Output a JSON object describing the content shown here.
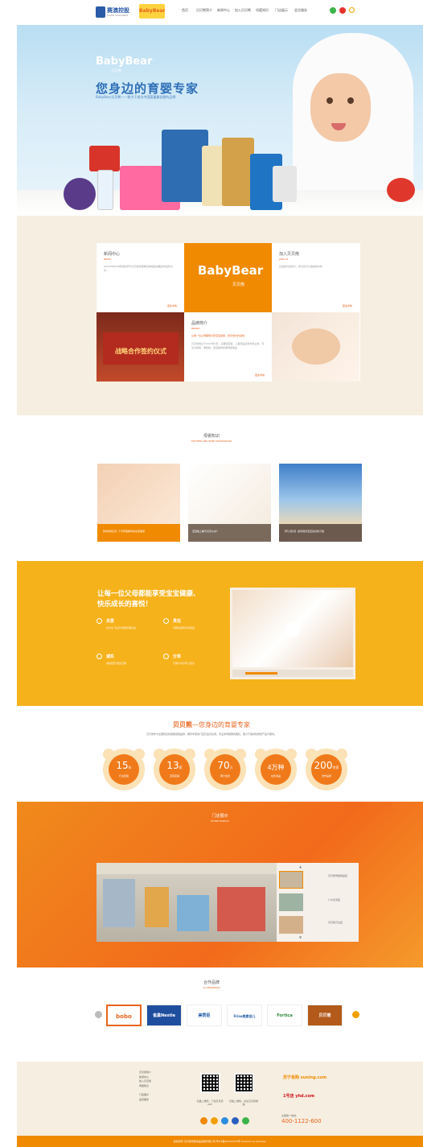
{
  "header": {
    "logo_text": "赛澳控股",
    "logo_sub": "SAIAO HOLDINGS",
    "brand_logo": "BabyBear",
    "nav": [
      "首页",
      "贝贝熊简介",
      "新闻中心",
      "加入贝贝熊",
      "母婴知识",
      "门店展示",
      "会员服务"
    ],
    "icons": [
      "wechat-icon",
      "weibo-icon",
      "search-icon"
    ]
  },
  "hero": {
    "brand": "BabyBear",
    "brand_cn": "贝贝熊",
    "headline": "您身边的育婴专家",
    "subline": "BabyBear贝贝熊——致力于成为中国婴童最信赖的品牌"
  },
  "news": {
    "news_title": "新闻中心",
    "news_en": "NEWS",
    "news_text": "MAYCHERION孕婴世界与贝贝熊母婴联合体组成战略合作签约仪式...",
    "news_more": "更多详情",
    "center_logo": "BabyBear",
    "center_logo_cn": "贝贝熊",
    "join_title": "加入贝贝熊",
    "join_en": "JOIN US",
    "join_text": "正是我们的努力，成为您可以信赖的伙伴",
    "join_more": "更多详情",
    "sign_banner": "战略合作签约仪式",
    "brand_title": "品牌简介",
    "brand_en": "BRAND",
    "brand_q": "让每一位父母都能享受宝宝健康、快乐成长的喜悦",
    "brand_text": "贝贝熊成立于2003年3月，主要经营婴、儿童用品全新零售业务，专注为妈妈、准妈妈、宝宝提供优质母婴用品",
    "brand_more": "更多详情"
  },
  "knowledge": {
    "title": "母婴知识",
    "sub": "MOTHER AND BABY KNOWLEDGE",
    "cards": [
      {
        "caption": "【孕妈妈知识】十月怀胎期间的注意事项"
      },
      {
        "caption": "宝宝晚上睡不好怎么办？"
      },
      {
        "caption": "【育儿知识】如何培养宝宝良好的习惯"
      }
    ]
  },
  "mission": {
    "slogan1": "让每一位父母都能享受宝宝健康、",
    "slogan2": "快乐成长的喜悦！",
    "values": [
      {
        "title": "关爱",
        "desc": "全方位 专业化母婴护理关爱"
      },
      {
        "title": "责任",
        "desc": "对每位顾客负责到底"
      },
      {
        "title": "诚实",
        "desc": "诚信经营 童叟无欺"
      },
      {
        "title": "分享",
        "desc": "与客户共享育儿知识"
      }
    ]
  },
  "stats": {
    "title_brand": "贝贝熊",
    "title_rest": "—您身边的育婴专家",
    "desc": "贝贝熊作为全国知名的婴童连锁品牌，拥有丰富的门店及会员资源，专业的母婴服务团队，致力于提供优质的产品与服务。",
    "items": [
      {
        "num": "15",
        "unit": "年",
        "label": "行业经验"
      },
      {
        "num": "13",
        "unit": "家",
        "label": "直营店铺"
      },
      {
        "num": "70",
        "unit": "万",
        "label": "累计会员"
      },
      {
        "num": "4万种",
        "unit": "",
        "label": "在售商品"
      },
      {
        "num": "200",
        "unit": "余家",
        "label": "合作品牌"
      }
    ]
  },
  "stores": {
    "title": "门店展示",
    "sub": "STORE DISPLAY",
    "thumbs": [
      "贝贝熊母婴用品店",
      "广州天河店",
      "贝贝熊万达店"
    ]
  },
  "partners": {
    "title": "合作品牌",
    "sub": "CO-BRANDING",
    "brands": [
      "bobo",
      "雀巢Nestle",
      "美赞臣",
      "Friso美素佳儿",
      "Fortica",
      "贝贝熊"
    ]
  },
  "footer": {
    "links": [
      "贝贝熊简介",
      "新闻中心",
      "加入贝贝熊",
      "母婴知识",
      "门店展示",
      "会员服务"
    ],
    "qr1": "扫描二维码，下载贝贝熊APP",
    "qr2": "扫描二维码，关注贝贝熊微信",
    "shop1": "苏宁易购 suning.com",
    "shop2": "1号店 yhd.com",
    "hotline_label": "全国统一热线：",
    "hotline": "400-1122-600",
    "copyright": "版权所有 贝贝熊母婴用品连锁有限公司  粤ICP备XXXXXXXX号  Powered by qianxiao"
  },
  "colors": {
    "accent": "#f08a00",
    "blue": "#2e6fb8",
    "beige": "#f6eee0",
    "yellow": "#f6b21b"
  }
}
